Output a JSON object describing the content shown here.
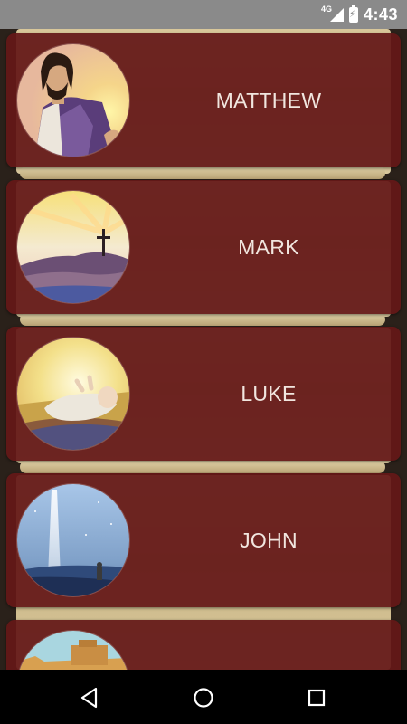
{
  "status_bar": {
    "network": "4G",
    "time": "4:43",
    "icons": [
      "signal-icon",
      "battery-charging-icon"
    ]
  },
  "gospels": [
    {
      "label": "MATTHEW",
      "image": "jesus-portrait-icon"
    },
    {
      "label": "MARK",
      "image": "cross-on-hill-icon"
    },
    {
      "label": "LUKE",
      "image": "infant-in-manger-icon"
    },
    {
      "label": "JOHN",
      "image": "light-beam-icon"
    },
    {
      "label": "",
      "image": "ancient-city-icon"
    }
  ],
  "colors": {
    "card": "#641818",
    "card_text": "#f1e6df",
    "parchment": "#d8c79a",
    "status_bar": "#8a8a8a",
    "nav_bar": "#000000"
  },
  "nav_bar": {
    "buttons": [
      "back-icon",
      "home-icon",
      "recents-icon"
    ]
  }
}
